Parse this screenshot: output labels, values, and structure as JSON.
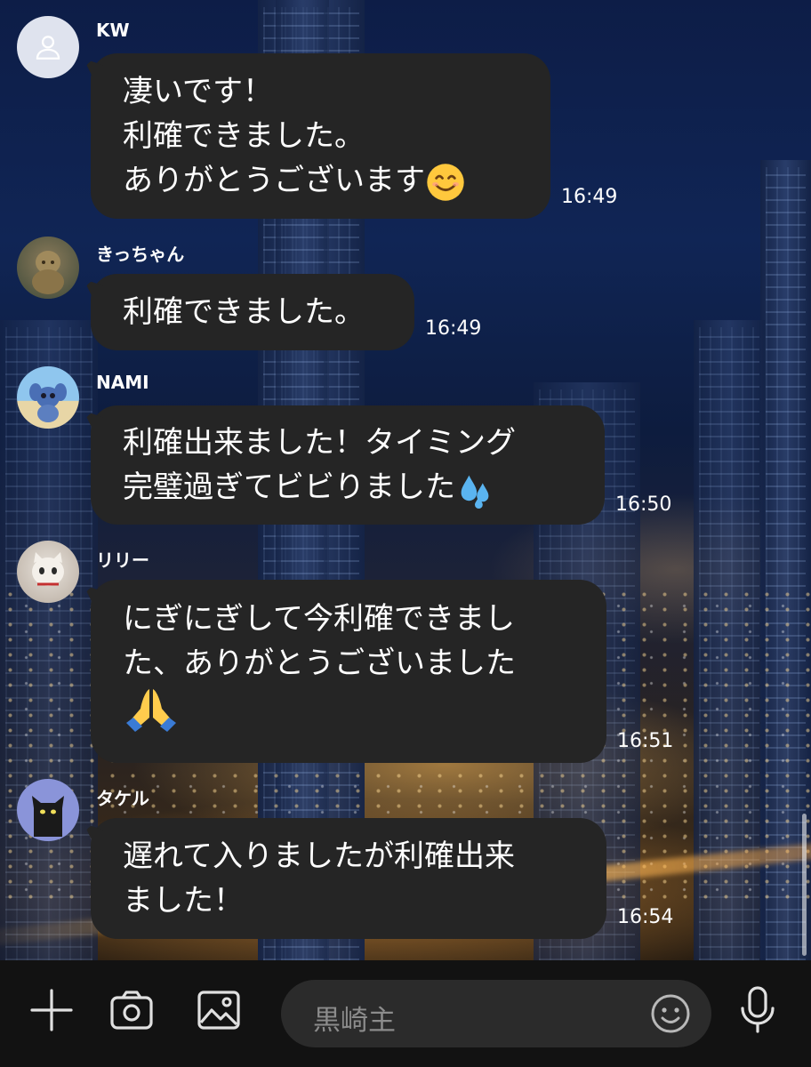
{
  "messages": [
    {
      "sender": "KW",
      "lines": [
        "凄いです！",
        "利確できました。",
        "ありがとうございます"
      ],
      "emoji": "smiling-face-icon",
      "time": "16:49"
    },
    {
      "sender": "きっちゃん",
      "lines": [
        "利確できました。"
      ],
      "time": "16:49"
    },
    {
      "sender": "NAMI",
      "lines": [
        "利確出来ました！タイミング",
        "完璧過ぎてビビりました"
      ],
      "emoji": "sweat-droplets-icon",
      "time": "16:50"
    },
    {
      "sender": "リリー",
      "lines": [
        "にぎにぎして今利確できまし",
        "た、ありがとうございました"
      ],
      "emoji": "folded-hands-icon",
      "time": "16:51"
    },
    {
      "sender": "タケル",
      "lines": [
        "遅れて入りましたが利確出来",
        "ました！"
      ],
      "time": "16:54"
    }
  ],
  "composer": {
    "text": "黒崎主",
    "icons": [
      "plus-icon",
      "camera-icon",
      "image-icon",
      "emoji-icon",
      "microphone-icon"
    ]
  },
  "colors": {
    "bubble": "#252525",
    "text": "#ffffff",
    "bar": "#121212"
  }
}
